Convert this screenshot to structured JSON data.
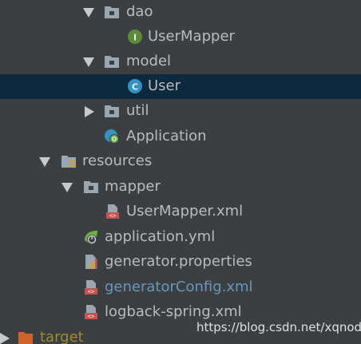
{
  "tree": {
    "dao": {
      "label": "dao",
      "icon": "folder-icon",
      "expanded": true
    },
    "usermapper_interface": {
      "label": "UserMapper",
      "icon": "interface-icon",
      "badge": "I"
    },
    "model": {
      "label": "model",
      "icon": "folder-icon",
      "expanded": true
    },
    "user_class": {
      "label": "User",
      "icon": "class-icon",
      "badge": "C",
      "selected": true
    },
    "util": {
      "label": "util",
      "icon": "folder-icon",
      "expanded": false
    },
    "application": {
      "label": "Application",
      "icon": "spring-boot-class-icon"
    },
    "resources": {
      "label": "resources",
      "icon": "resources-folder-icon",
      "expanded": true
    },
    "mapper": {
      "label": "mapper",
      "icon": "folder-icon",
      "expanded": true
    },
    "usermapper_xml": {
      "label": "UserMapper.xml",
      "icon": "xml-file-icon"
    },
    "application_yml": {
      "label": "application.yml",
      "icon": "spring-yml-icon"
    },
    "generator_properties": {
      "label": "generator.properties",
      "icon": "properties-file-icon"
    },
    "generator_config": {
      "label": "generatorConfig.xml",
      "icon": "xml-file-icon",
      "modified": true
    },
    "logback": {
      "label": "logback-spring.xml",
      "icon": "xml-file-icon"
    },
    "target": {
      "label": "target",
      "icon": "excluded-folder-icon",
      "expanded": false
    }
  },
  "colors": {
    "background": "#3c3f41",
    "selection": "#0d293e",
    "text": "#bbbbbb",
    "modified_text": "#6897bb",
    "excluded_text": "#a08b2a"
  },
  "watermark": "https://blog.csdn.net/xqnode"
}
